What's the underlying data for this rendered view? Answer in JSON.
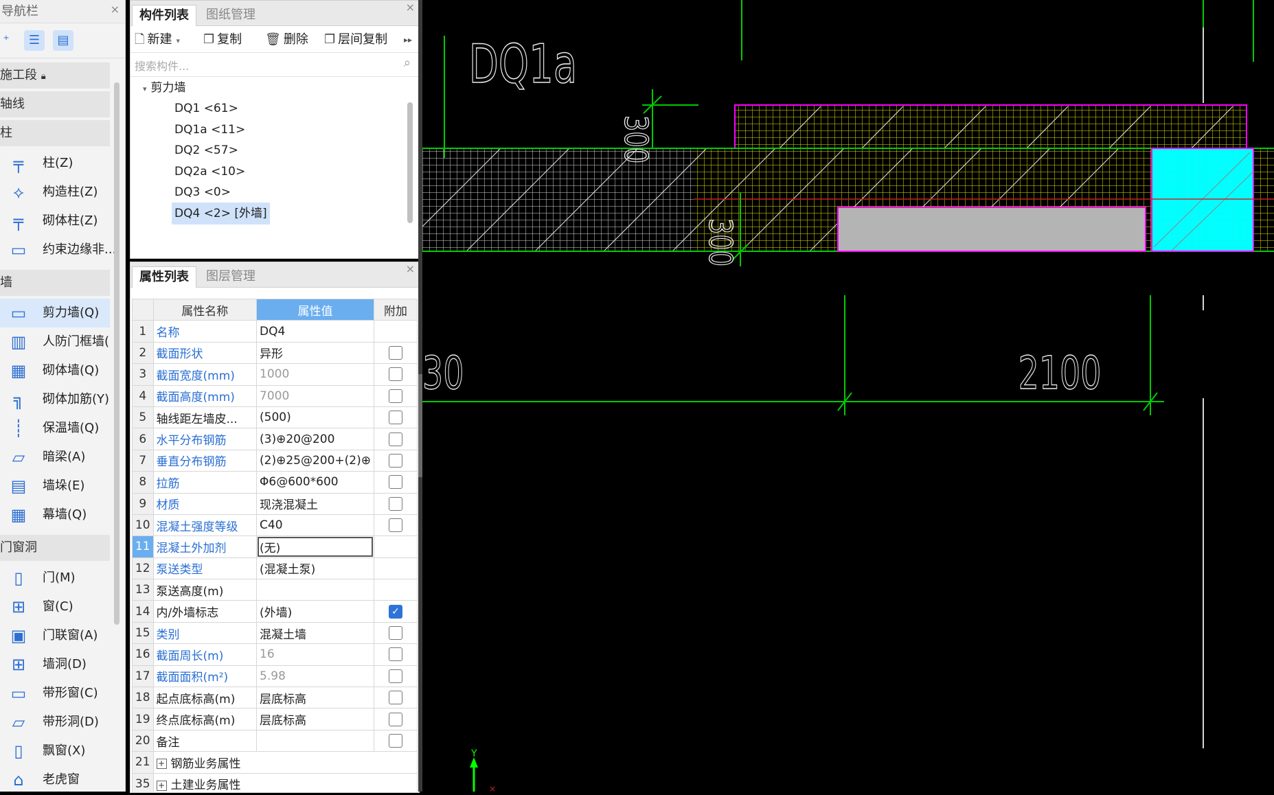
{
  "nav": {
    "title": "导航栏",
    "close": "×",
    "sections": {
      "stage": "施工段",
      "axis": "轴线",
      "column": "柱",
      "wall": "墙",
      "opening": "门窗洞"
    },
    "column_items": [
      "柱(Z)",
      "构造柱(Z)",
      "砌体柱(Z)",
      "约束边缘非..."
    ],
    "wall_items": [
      "剪力墙(Q)",
      "人防门框墙(",
      "砌体墙(Q)",
      "砌体加筋(Y)",
      "保温墙(Q)",
      "暗梁(A)",
      "墙垛(E)",
      "幕墙(Q)"
    ],
    "opening_items": [
      "门(M)",
      "窗(C)",
      "门联窗(A)",
      "墙洞(D)",
      "带形窗(C)",
      "带形洞(D)",
      "飘窗(X)",
      "老虎窗"
    ]
  },
  "comp": {
    "tabs": [
      "构件列表",
      "图纸管理"
    ],
    "close": "×",
    "toolbar": {
      "new": "新建",
      "copy": "复制",
      "delete": "删除",
      "floor_copy": "层间复制",
      "more": "▸▸"
    },
    "search_placeholder": "搜索构件...",
    "tree_root": "剪力墙",
    "tree_items": [
      "DQ1 <61>",
      "DQ1a <11>",
      "DQ2 <57>",
      "DQ2a <10>",
      "DQ3 <0>",
      "DQ4 <2> [外墙]"
    ]
  },
  "prop": {
    "tabs": [
      "属性列表",
      "图层管理"
    ],
    "close": "×",
    "headers": {
      "num": "",
      "name": "属性名称",
      "value": "属性值",
      "extra": "附加"
    },
    "rows": [
      {
        "n": "1",
        "name": "名称",
        "value": "DQ4",
        "blue": true,
        "gray": false,
        "chk": "none"
      },
      {
        "n": "2",
        "name": "截面形状",
        "value": "异形",
        "blue": true,
        "gray": false,
        "chk": "off"
      },
      {
        "n": "3",
        "name": "截面宽度(mm)",
        "value": "1000",
        "blue": true,
        "gray": true,
        "chk": "off"
      },
      {
        "n": "4",
        "name": "截面高度(mm)",
        "value": "7000",
        "blue": true,
        "gray": true,
        "chk": "off"
      },
      {
        "n": "5",
        "name": "轴线距左墙皮...",
        "value": "(500)",
        "blue": false,
        "gray": false,
        "chk": "off"
      },
      {
        "n": "6",
        "name": "水平分布钢筋",
        "value": "(3)⊕20@200",
        "blue": true,
        "gray": false,
        "chk": "off"
      },
      {
        "n": "7",
        "name": "垂直分布钢筋",
        "value": "(2)⊕25@200+(2)⊕",
        "blue": true,
        "gray": false,
        "chk": "off"
      },
      {
        "n": "8",
        "name": "拉筋",
        "value": "Φ6@600*600",
        "blue": true,
        "gray": false,
        "chk": "off"
      },
      {
        "n": "9",
        "name": "材质",
        "value": "现浇混凝土",
        "blue": true,
        "gray": false,
        "chk": "off"
      },
      {
        "n": "10",
        "name": "混凝土强度等级",
        "value": "C40",
        "blue": true,
        "gray": false,
        "chk": "off"
      },
      {
        "n": "11",
        "name": "混凝土外加剂",
        "value": "(无)",
        "blue": true,
        "gray": false,
        "chk": "none"
      },
      {
        "n": "12",
        "name": "泵送类型",
        "value": "(混凝土泵)",
        "blue": true,
        "gray": false,
        "chk": "none"
      },
      {
        "n": "13",
        "name": "泵送高度(m)",
        "value": "",
        "blue": false,
        "gray": false,
        "chk": "none"
      },
      {
        "n": "14",
        "name": "内/外墙标志",
        "value": "(外墙)",
        "blue": false,
        "gray": false,
        "chk": "on"
      },
      {
        "n": "15",
        "name": "类别",
        "value": "混凝土墙",
        "blue": true,
        "gray": false,
        "chk": "off"
      },
      {
        "n": "16",
        "name": "截面周长(m)",
        "value": "16",
        "blue": true,
        "gray": true,
        "chk": "off"
      },
      {
        "n": "17",
        "name": "截面面积(m²)",
        "value": "5.98",
        "blue": true,
        "gray": true,
        "chk": "off"
      },
      {
        "n": "18",
        "name": "起点底标高(m)",
        "value": "层底标高",
        "blue": false,
        "gray": false,
        "chk": "off"
      },
      {
        "n": "19",
        "name": "终点底标高(m)",
        "value": "层底标高",
        "blue": false,
        "gray": false,
        "chk": "off"
      },
      {
        "n": "20",
        "name": "备注",
        "value": "",
        "blue": false,
        "gray": false,
        "chk": "off"
      },
      {
        "n": "21",
        "name": "钢筋业务属性",
        "value": "",
        "blue": false,
        "gray": false,
        "chk": "none",
        "group": true
      },
      {
        "n": "35",
        "name": "土建业务属性",
        "value": "",
        "blue": false,
        "gray": false,
        "chk": "none",
        "group": true
      }
    ],
    "active_row": "11"
  },
  "canvas": {
    "label_dq1a": "DQ1a",
    "dim_left_vertical": "300",
    "dim_left_vertical_lower": "300",
    "dim_partial": "30",
    "dim_2100": "2100",
    "axis_y": "Y",
    "colors": {
      "grid_yellow": "#e6e600",
      "grid_white": "#d8d8d8",
      "magenta": "#ff00ff",
      "cyan": "#00ffff",
      "green": "#00cc00",
      "gray_fill": "#b4b4b4"
    }
  }
}
